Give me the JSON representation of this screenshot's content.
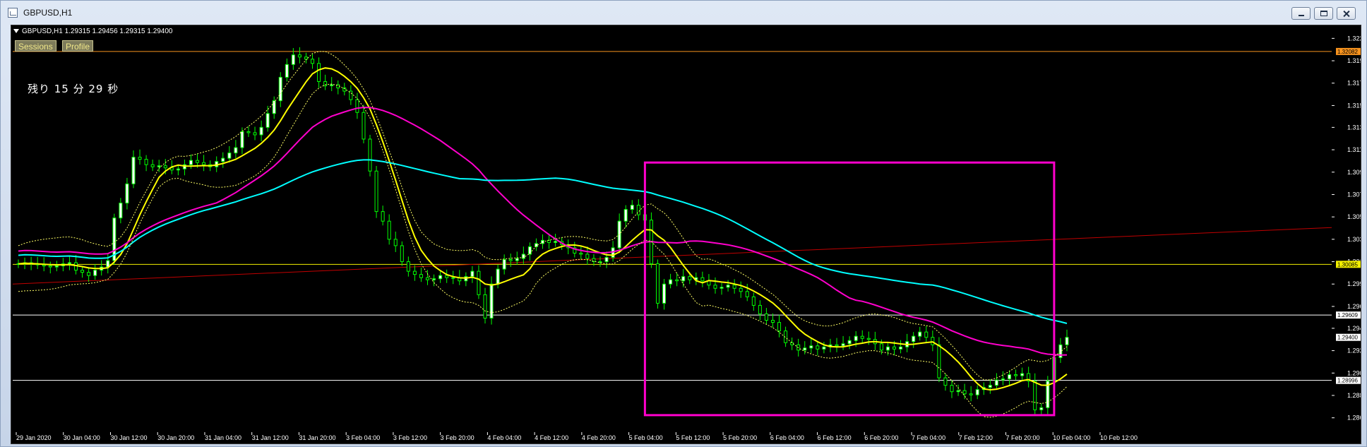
{
  "window": {
    "title": "GBPUSD,H1",
    "controls": {
      "minimize": "",
      "maximize": "",
      "close": ""
    }
  },
  "chart": {
    "symbol_line": "GBPUSD,H1  1.29315 1.29456 1.29315 1.29400",
    "buttons": [
      "Sessions",
      "Profile"
    ],
    "remaining": "残り 15 分 29 秒"
  },
  "chart_data": {
    "type": "candlestick",
    "ylim": [
      1.2855,
      1.323
    ],
    "y_ticks": [
      "1.32205",
      "1.31995",
      "1.31785",
      "1.31575",
      "1.31370",
      "1.31160",
      "1.30950",
      "1.30740",
      "1.30530",
      "1.30320",
      "1.30110",
      "1.29900",
      "1.29690",
      "1.29485",
      "1.29275",
      "1.29065",
      "1.28855",
      "1.28645"
    ],
    "x_labels": [
      "29 Jan 2020",
      "30 Jan 04:00",
      "30 Jan 12:00",
      "30 Jan 20:00",
      "31 Jan 04:00",
      "31 Jan 12:00",
      "31 Jan 20:00",
      "3 Feb 04:00",
      "3 Feb 12:00",
      "3 Feb 20:00",
      "4 Feb 04:00",
      "4 Feb 12:00",
      "4 Feb 20:00",
      "5 Feb 04:00",
      "5 Feb 12:00",
      "5 Feb 20:00",
      "6 Feb 04:00",
      "6 Feb 12:00",
      "6 Feb 20:00",
      "7 Feb 04:00",
      "7 Feb 12:00",
      "7 Feb 20:00",
      "10 Feb 04:00",
      "10 Feb 12:00"
    ],
    "price_labels": [
      {
        "value": "1.32082",
        "color": "#f7931e",
        "text_color": "#000"
      },
      {
        "value": "1.30085",
        "color": "#f2ef00",
        "text_color": "#000"
      },
      {
        "value": "1.29609",
        "color": "#ffffff",
        "text_color": "#000"
      },
      {
        "value": "1.29400",
        "color": "#ffffff",
        "text_color": "#000"
      },
      {
        "value": "1.28996",
        "color": "#ffffff",
        "text_color": "#000"
      }
    ],
    "horizontal_lines": [
      1.32082,
      1.30085,
      1.29609,
      1.28996
    ],
    "highlight_box": {
      "color": "#ff00cc",
      "x_start": "5 Feb 04:00",
      "x_end": "10 Feb 12:00",
      "y_range": [
        1.2867,
        1.3104
      ]
    },
    "candle_color": "#00ff00",
    "indicator_colors": {
      "ma_fast": "#ffff00",
      "ma_mid": "#ff00cc",
      "ma_slow": "#00ffff",
      "band": "#ffff66",
      "trendline": "#c00000"
    },
    "candles": [
      1.3009,
      1.301,
      1.3009,
      1.3008,
      1.3007,
      1.3006,
      1.3007,
      1.3009,
      1.301,
      1.3003,
      1.3001,
      1.2998,
      1.3003,
      1.3006,
      1.3012,
      1.3052,
      1.3066,
      1.3084,
      1.3109,
      1.3107,
      1.3102,
      1.31,
      1.3101,
      1.3099,
      1.3097,
      1.3098,
      1.3102,
      1.3106,
      1.3104,
      1.3102,
      1.31,
      1.3105,
      1.3108,
      1.3113,
      1.3118,
      1.3133,
      1.3132,
      1.313,
      1.3137,
      1.315,
      1.3162,
      1.3184,
      1.3196,
      1.3205,
      1.3203,
      1.3201,
      1.3197,
      1.318,
      1.3176,
      1.3177,
      1.3174,
      1.3171,
      1.3163,
      1.3151,
      1.3126,
      1.3096,
      1.3058,
      1.3049,
      1.3032,
      1.3026,
      1.3011,
      1.3002,
      1.2999,
      1.2996,
      1.2994,
      1.2995,
      1.2998,
      1.2996,
      1.2996,
      1.2993,
      1.2997,
      1.3002,
      1.298,
      1.2958,
      1.299,
      1.3004,
      1.3013,
      1.3012,
      1.3014,
      1.3018,
      1.3025,
      1.3028,
      1.3031,
      1.3029,
      1.303,
      1.3027,
      1.3024,
      1.3019,
      1.3018,
      1.3014,
      1.3011,
      1.3011,
      1.3015,
      1.3024,
      1.3049,
      1.306,
      1.3064,
      1.3055,
      1.305,
      1.3009,
      1.2972,
      1.299,
      1.2994,
      1.2993,
      1.2997,
      1.2994,
      1.2996,
      1.2993,
      1.2989,
      1.2986,
      1.2987,
      1.2989,
      1.2986,
      1.2983,
      1.2978,
      1.297,
      1.2962,
      1.2956,
      1.2954,
      1.2946,
      1.2935,
      1.2933,
      1.2928,
      1.293,
      1.2932,
      1.2929,
      1.2931,
      1.2933,
      1.2932,
      1.2934,
      1.2937,
      1.2941,
      1.2939,
      1.2938,
      1.2934,
      1.2928,
      1.2931,
      1.2929,
      1.2931,
      1.2936,
      1.2941,
      1.2945,
      1.294,
      1.2933,
      1.2902,
      1.2895,
      1.2889,
      1.289,
      1.2887,
      1.2886,
      1.2891,
      1.2893,
      1.2895,
      1.29,
      1.2901,
      1.2905,
      1.2904,
      1.2906,
      1.2899,
      1.2872,
      1.2874,
      1.2899,
      1.2921,
      1.2933,
      1.294
    ]
  }
}
